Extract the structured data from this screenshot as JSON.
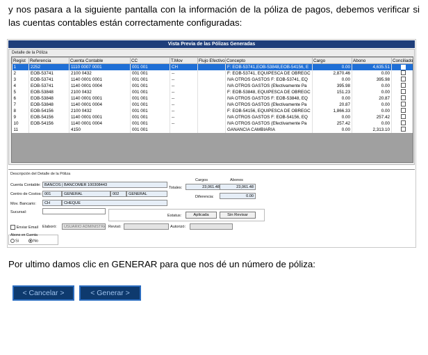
{
  "intro_text": "y nos pasara a la siguiente pantalla con la información de la póliza de pagos, debemos verificar si las cuentas contables están correctamente configuradas:",
  "window": {
    "title": "Vista Previa de las Pólizas Generadas",
    "grid_group": "Detalle de la Póliza",
    "columns": [
      "Regist",
      "Referencia",
      "Cuenta Contable",
      "CC",
      "T.Mov",
      "Flujo Efectivo",
      "Concepto",
      "Cargo",
      "Abono",
      "Conciliado"
    ],
    "rows": [
      [
        "1",
        "2252",
        "1110 0007 0001",
        "001 001",
        "CH",
        "",
        "F: EOB-53741,EOB-53848,EOB-54156, E",
        "0.00",
        "4,635.51"
      ],
      [
        "2",
        "EOB-53741",
        "2100 0432",
        "001 001",
        "--",
        "",
        "F: EOB-53741, EQUIPESCA DE OBREGC",
        "2,870.46",
        "0.00"
      ],
      [
        "3",
        "EOB-53741",
        "1140 0001 0001",
        "001 001",
        "--",
        "",
        "IVA OTROS GASTOS F: EOB-53741, EQ",
        "0.00",
        "395.98"
      ],
      [
        "4",
        "EOB-53741",
        "1140 0001 0004",
        "001 001",
        "--",
        "",
        "IVA OTROS GASTOS (Efectivamente Pa",
        "395.98",
        "0.00"
      ],
      [
        "5",
        "EOB-53848",
        "2100 0432",
        "001 001",
        "--",
        "",
        "F: EOB-53848, EQUIPESCA DE OBREGC",
        "151.23",
        "0.00"
      ],
      [
        "6",
        "EOB-53848",
        "1140 0001 0001",
        "001 001",
        "--",
        "",
        "IVA OTROS GASTOS F: EOB-53848, EQ",
        "0.00",
        "20.87"
      ],
      [
        "7",
        "EOB-53848",
        "1140 0001 0004",
        "001 001",
        "--",
        "",
        "IVA OTROS GASTOS (Efectivamente Pa",
        "20.87",
        "0.00"
      ],
      [
        "8",
        "EOB-54156",
        "2100 0432",
        "001 001",
        "--",
        "",
        "F: EOB-54156, EQUIPESCA DE OBREGC",
        "1,866.33",
        "0.00"
      ],
      [
        "9",
        "EOB-54156",
        "1140 0001 0001",
        "001 001",
        "--",
        "",
        "IVA OTROS GASTOS F: EOB-54156, EQ",
        "0.00",
        "257.42"
      ],
      [
        "10",
        "EOB-54156",
        "1140 0001 0004",
        "001 001",
        "--",
        "",
        "IVA OTROS GASTOS (Efectivamente Pa",
        "257.42",
        "0.00"
      ],
      [
        "11",
        "",
        "4150",
        "001 001",
        "",
        "",
        "GANANCIA CAMBIARIA",
        "0.00",
        "2,313.10"
      ]
    ],
    "detail": {
      "group_label": "Descripción del Detalle de la Póliza",
      "cuenta_label": "Cuenta Contable:",
      "cuenta_value": "BANCOS | BANCOMER 100308443",
      "centro_label": "Centro de Costos:",
      "centro_code1": "001",
      "centro_name1": "GENERAL",
      "centro_code2": "002",
      "centro_name2": "GENERAL",
      "mov_label": "Mov. Bancario:",
      "mov_code": "CH",
      "mov_name": "CHEQUE",
      "sucursal_label": "Sucursal:",
      "cargos_label": "Cargos",
      "abonos_label": "Abonos",
      "totales_label": "Totales:",
      "total_cargos": "23,061.48",
      "total_abonos": "23,061.48",
      "diferencia_label": "Diferencia:",
      "diferencia_value": "0.00",
      "estatus_label": "Estatus:",
      "aplicada_label": "Aplicada",
      "sin_revisar_label": "Sin Revisar",
      "enviar_email_label": "Enviar Email",
      "elaboro_label": "Elaboró:",
      "elaboro_value": "USUARIO ADMINISTRAC",
      "reviso_label": "Revisó:",
      "autorizo_label": "Autorizó:",
      "abono_cuenta_label": "Abono en Cuenta",
      "si_label": "Si",
      "no_label": "No"
    }
  },
  "outro_text": "Por ultimo damos clic en GENERAR para que nos dé un número de póliza:",
  "buttons": {
    "cancel": "< Cancelar >",
    "generate": "< Generar >"
  }
}
